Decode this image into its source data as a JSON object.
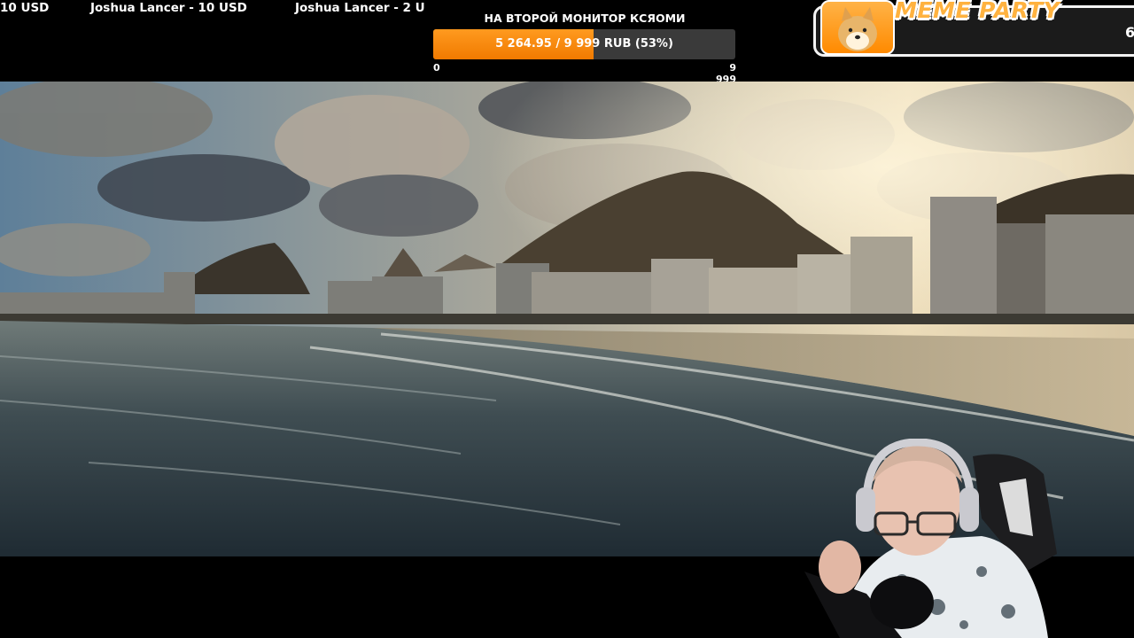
{
  "ticker": {
    "items": [
      "10 USD",
      "Joshua Lancer - 10 USD",
      "Joshua Lancer - 2 U"
    ]
  },
  "goal": {
    "title": "НА ВТОРОЙ МОНИТОР КСЯОМИ",
    "progress_text": "5 264.95 / 9 999 RUB (53%)",
    "progress": 0.53,
    "min_label": "0",
    "max_label": "9 999",
    "fill_color": "#f5860b"
  },
  "meme_party": {
    "title": "MEME PARTY",
    "counter": "6",
    "icon": "doge-icon"
  },
  "video": {
    "description_icon": "beach-city-video"
  },
  "webcam": {
    "icon": "streamer-webcam"
  }
}
